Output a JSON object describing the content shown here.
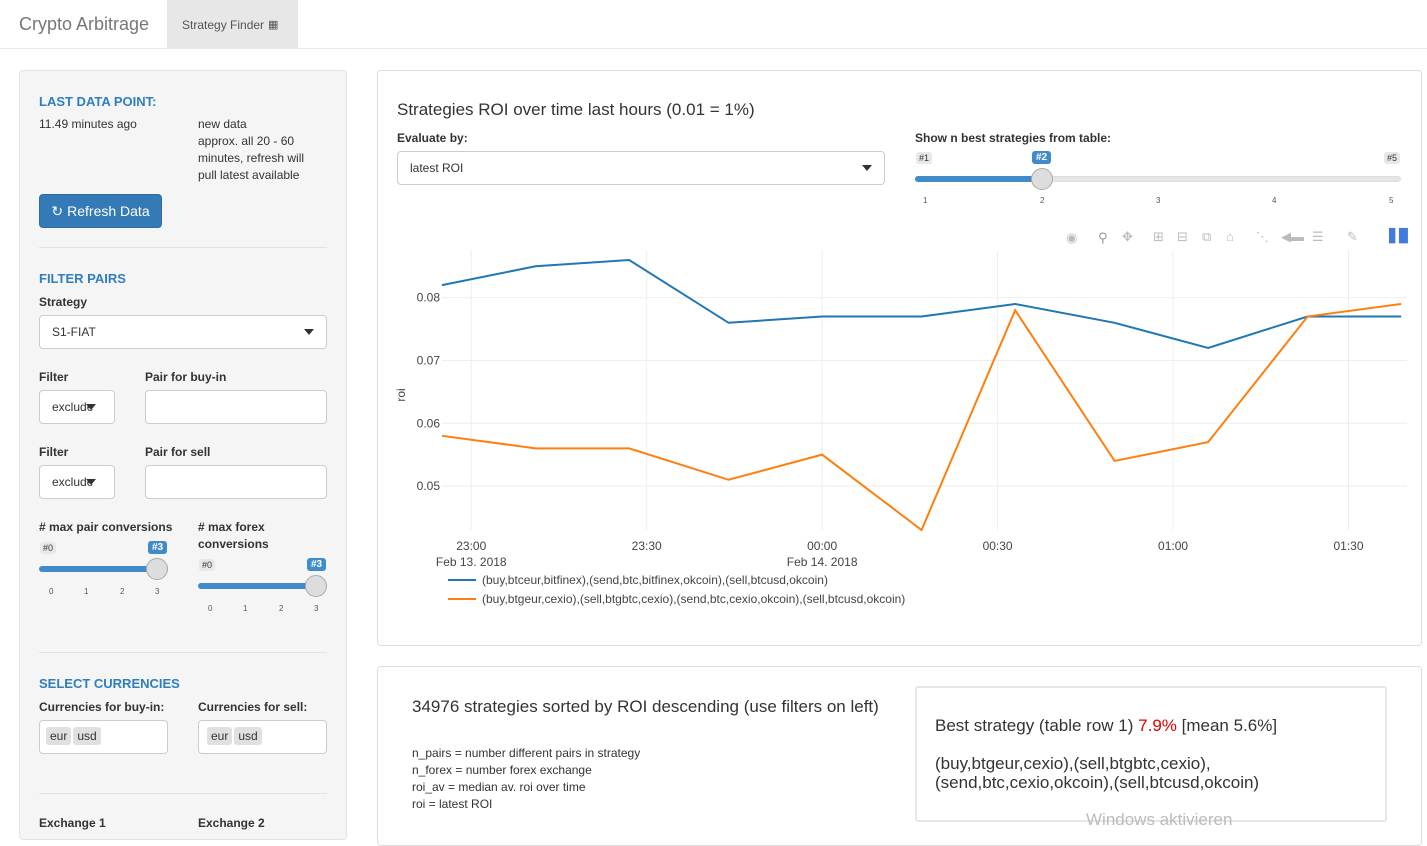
{
  "nav": {
    "brand": "Crypto Arbitrage",
    "tab_label": "Strategy Finder"
  },
  "sidebar": {
    "last_data_heading": "LAST DATA POINT:",
    "last_data_value": "11.49 minutes ago",
    "new_data_note_1": "new data",
    "new_data_note_2": "approx. all 20 - 60",
    "new_data_note_3": "minutes, refresh will",
    "new_data_note_4": "pull latest available",
    "refresh_label": "Refresh Data",
    "filter_heading": "FILTER PAIRS",
    "strategy_label": "Strategy",
    "strategy_value": "S1-FIAT",
    "filter_label_1": "Filter",
    "filter_value_1": "exclude",
    "buyin_pair_label": "Pair for buy-in",
    "filter_label_2": "Filter",
    "filter_value_2": "exclude",
    "sell_pair_label": "Pair for sell",
    "max_pair_label": "# max pair conversions",
    "max_forex_label_1": "# max forex",
    "max_forex_label_2": "conversions",
    "slider_pair": {
      "min_label": "#0",
      "current_label": "#3",
      "value": 3,
      "min": 0,
      "max": 3,
      "ticks": [
        "0",
        "1",
        "2",
        "3"
      ]
    },
    "slider_forex": {
      "min_label": "#0",
      "current_label": "#3",
      "value": 3,
      "min": 0,
      "max": 3,
      "ticks": [
        "0",
        "1",
        "2",
        "3"
      ]
    },
    "currencies_heading": "SELECT CURRENCIES",
    "buyin_currencies_label": "Currencies for buy-in:",
    "buyin_currencies": [
      "eur",
      "usd"
    ],
    "sell_currencies_label": "Currencies for sell:",
    "sell_currencies": [
      "eur",
      "usd"
    ],
    "exchange1_label": "Exchange 1",
    "exchange2_label": "Exchange 2"
  },
  "chart_panel": {
    "title": "Strategies ROI over time last hours (0.01 = 1%)",
    "evaluate_label": "Evaluate by:",
    "evaluate_value": "latest ROI",
    "show_n_label": "Show n best strategies from table:",
    "slider_n": {
      "min_label": "#1",
      "current_label": "#2",
      "max_label": "#5",
      "value": 2,
      "min": 1,
      "max": 5,
      "ticks": [
        "1",
        "2",
        "3",
        "4",
        "5"
      ]
    },
    "modebar_icons": [
      "camera-icon",
      "zoom-icon",
      "pan-icon",
      "zoom-in-icon",
      "zoom-out-icon",
      "autoscale-icon",
      "home-icon",
      "spike-icon",
      "hover-closest-icon",
      "hover-compare-icon",
      "edit-icon",
      "plotly-logo-icon"
    ]
  },
  "chart_data": {
    "type": "line",
    "ylabel": "roi",
    "xlabel": "",
    "x": [
      "22:55",
      "23:11",
      "23:27",
      "23:44",
      "24:00",
      "24:17",
      "24:33",
      "24:50",
      "25:06",
      "25:23",
      "25:39"
    ],
    "x_ticks": [
      {
        "label": "23:00",
        "sub": "Feb 13. 2018"
      },
      {
        "label": "23:30",
        "sub": ""
      },
      {
        "label": "00:00",
        "sub": "Feb 14. 2018"
      },
      {
        "label": "00:30",
        "sub": ""
      },
      {
        "label": "01:00",
        "sub": ""
      },
      {
        "label": "01:30",
        "sub": ""
      }
    ],
    "y_ticks": [
      "0.08",
      "0.07",
      "0.06",
      "0.05"
    ],
    "ylim": [
      0.043,
      0.086
    ],
    "series": [
      {
        "name": "(buy,btceur,bitfinex),(send,btc,bitfinex,okcoin),(sell,btcusd,okcoin)",
        "color": "#1f77b4",
        "values": [
          0.082,
          0.085,
          0.086,
          0.076,
          0.077,
          0.077,
          0.079,
          0.076,
          0.072,
          0.077,
          0.077
        ]
      },
      {
        "name": "(buy,btgeur,cexio),(sell,btgbtc,cexio),(send,btc,cexio,okcoin),(sell,btcusd,okcoin)",
        "color": "#ff7f0e",
        "values": [
          0.058,
          0.056,
          0.056,
          0.051,
          0.055,
          0.043,
          0.078,
          0.054,
          0.057,
          0.077,
          0.079
        ]
      }
    ],
    "legend": "bottom-left",
    "grid": true
  },
  "table_panel": {
    "title": "34976 strategies sorted by ROI descending (use filters on left)",
    "legend_1": "n_pairs = number different pairs in strategy",
    "legend_2": "n_forex = number forex exchange",
    "legend_3": "roi_av = median av. roi over time",
    "legend_4": "roi = latest ROI",
    "best_prefix": "Best strategy (table row 1)",
    "best_roi": "7.9%",
    "best_mean": "[mean 5.6%]",
    "best_strategy_1": "(buy,btgeur,cexio),(sell,btgbtc,cexio),",
    "best_strategy_2": "(send,btc,cexio,okcoin),(sell,btcusd,okcoin)"
  },
  "colors": {
    "accent": "#337ab7",
    "heading": "#2f7ec0",
    "highlight": "#e00000"
  },
  "watermark": "Windows aktivieren"
}
